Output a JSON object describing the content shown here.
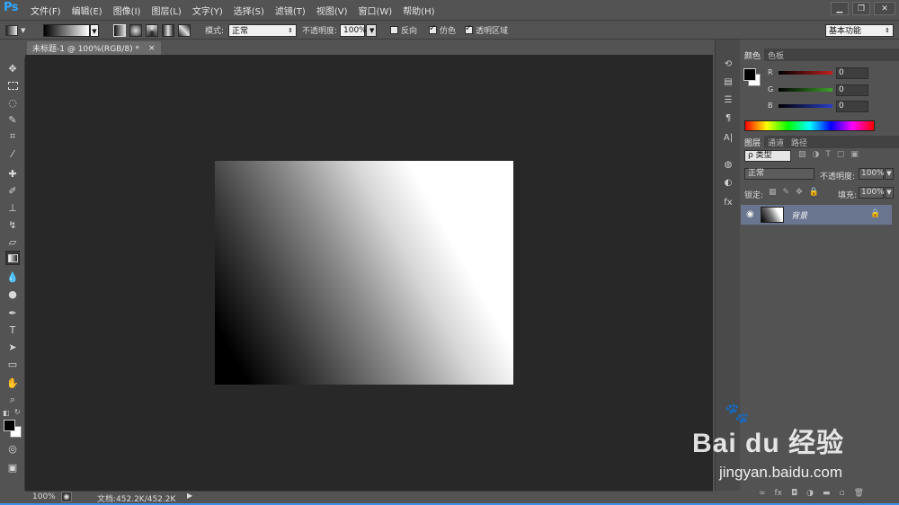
{
  "app": {
    "logo": "Ps"
  },
  "menu": {
    "items": [
      "文件(F)",
      "编辑(E)",
      "图像(I)",
      "图层(L)",
      "文字(Y)",
      "选择(S)",
      "滤镜(T)",
      "视图(V)",
      "窗口(W)",
      "帮助(H)"
    ]
  },
  "window_controls": {
    "minimize": "▁",
    "restore": "❐",
    "close": "✕"
  },
  "options": {
    "mode_label": "模式:",
    "mode_value": "正常",
    "opacity_label": "不透明度:",
    "opacity_value": "100%",
    "reverse_label": "反向",
    "dither_label": "仿色",
    "transparency_label": "透明区域",
    "workspace_value": "基本功能"
  },
  "document": {
    "tab_title": "未标题-1 @ 100%(RGB/8) *",
    "close": "×"
  },
  "status": {
    "zoom": "100%",
    "doc_info": "文档:452.2K/452.2K"
  },
  "color_panel": {
    "tabs": [
      "颜色",
      "色板"
    ],
    "r_label": "R",
    "r_value": "0",
    "g_label": "G",
    "g_value": "0",
    "b_label": "B",
    "b_value": "0",
    "r_color": "#c0201e",
    "g_color": "#3fa12a",
    "b_color": "#2a3ec8"
  },
  "layers_panel": {
    "tabs": [
      "图层",
      "通道",
      "路径"
    ],
    "filter_label": "ρ 类型",
    "blend_value": "正常",
    "opacity_label": "不透明度:",
    "opacity_value": "100%",
    "lock_label": "锁定:",
    "fill_label": "填充:",
    "fill_value": "100%",
    "layer_name": "背景"
  },
  "watermark": {
    "text": "Bai du 经验",
    "url": "jingyan.baidu.com"
  }
}
